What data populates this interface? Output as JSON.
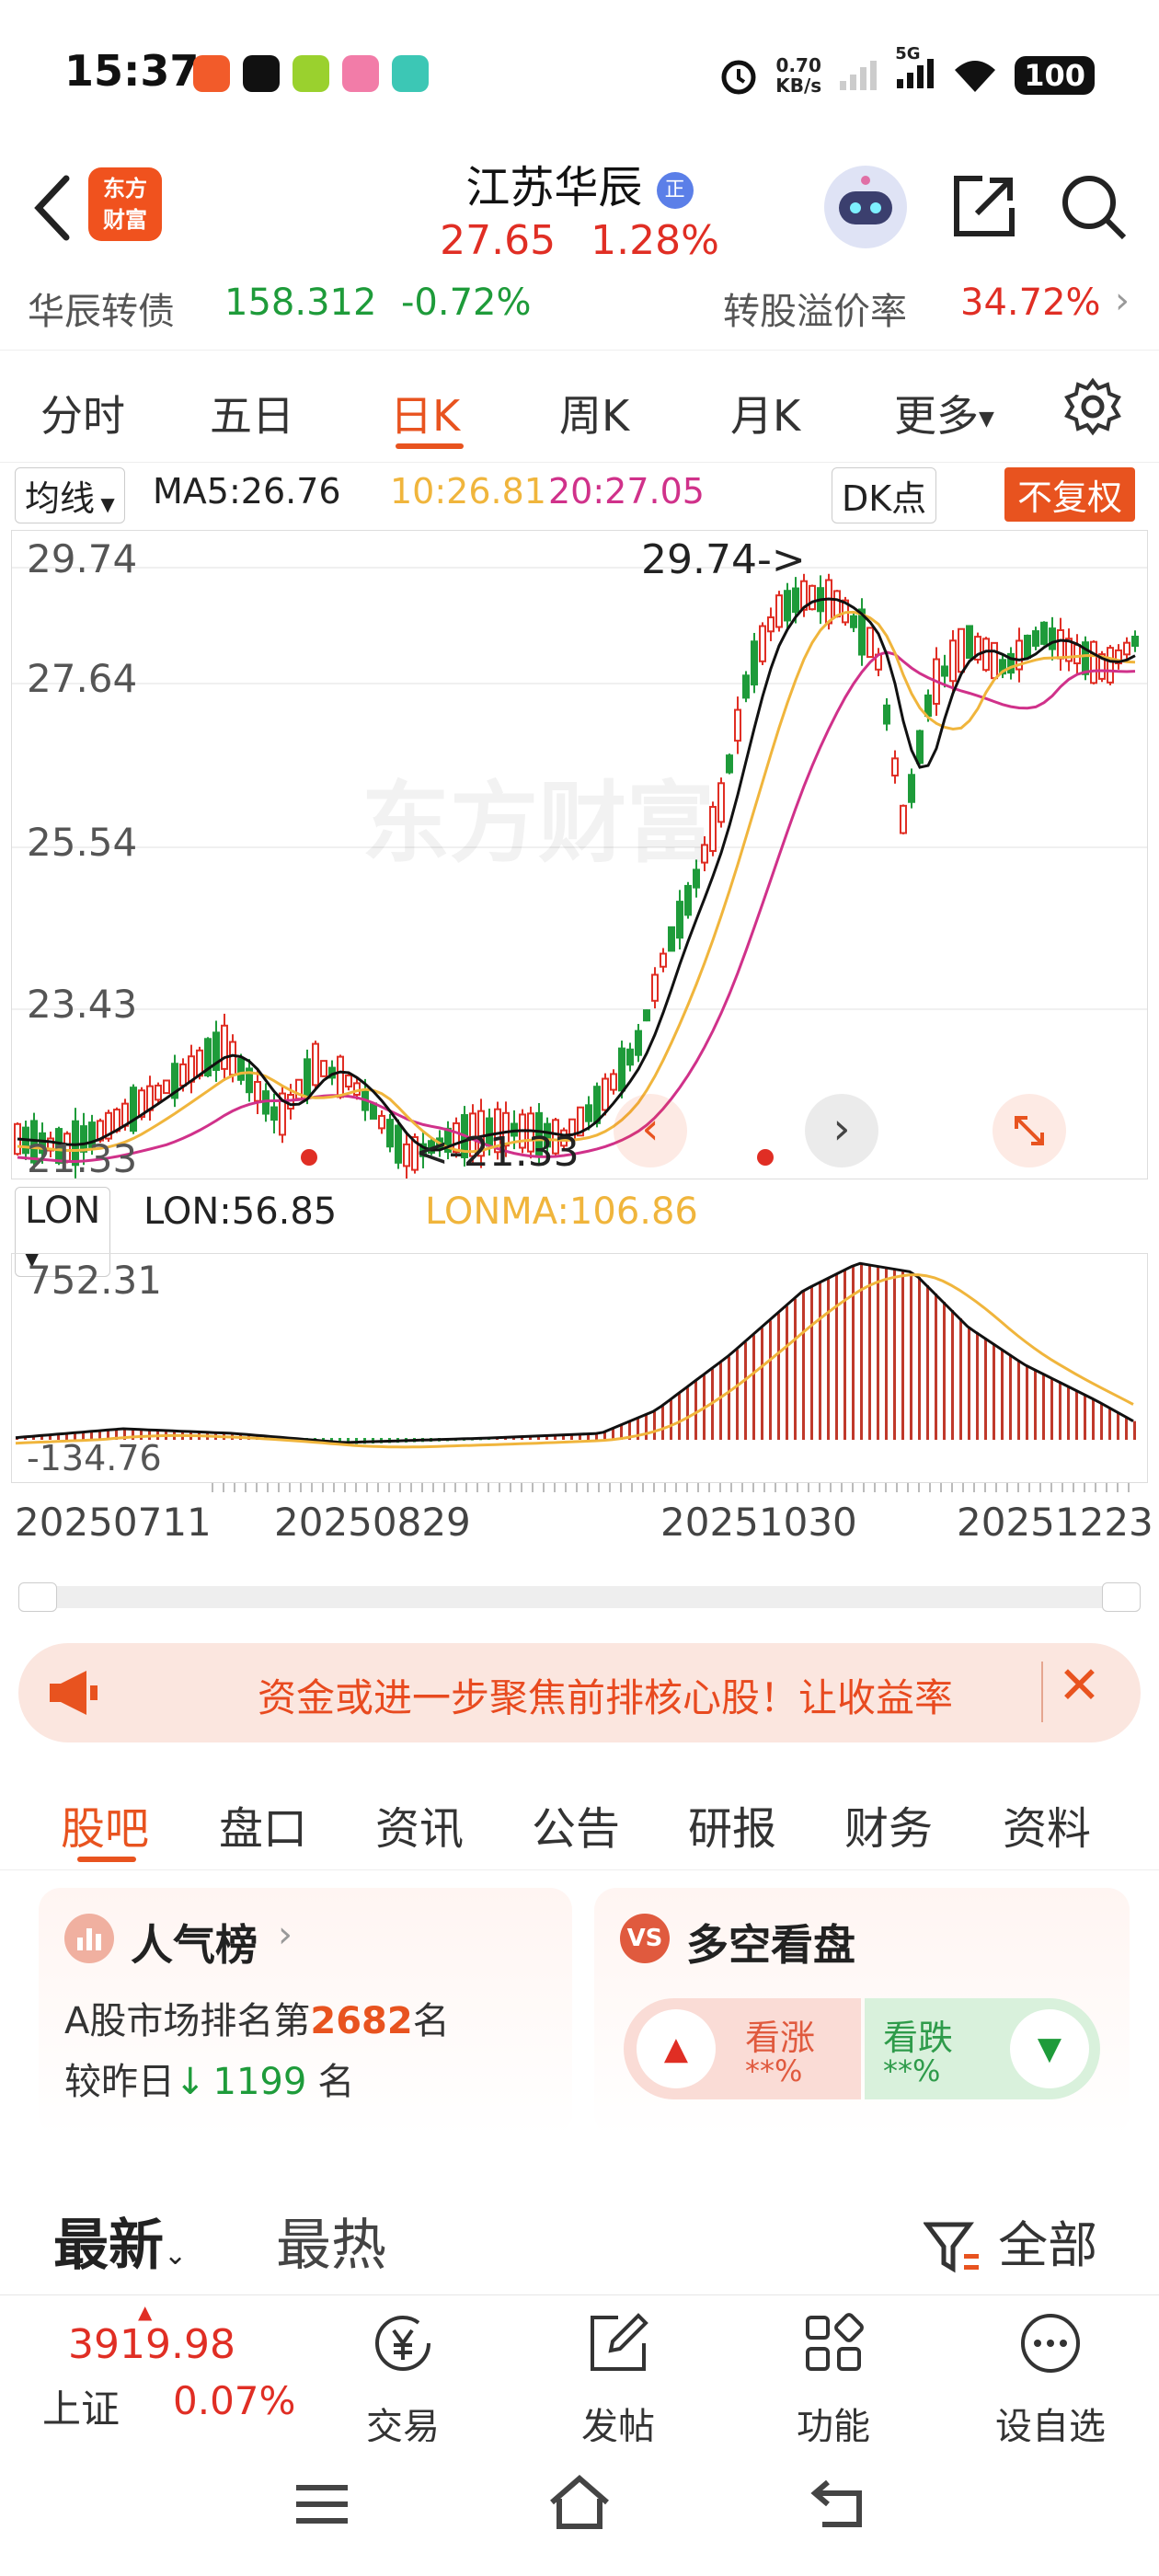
{
  "status_bar": {
    "time": "15:37",
    "net_speed_top": "0.70",
    "net_speed_bottom": "KB/s",
    "network": "5G",
    "battery": "100"
  },
  "header": {
    "logo_line1": "东方",
    "logo_line2": "财富",
    "stock_name": "江苏华辰",
    "badge": "正",
    "price": "27.65",
    "change_pct": "1.28%"
  },
  "convertible_bond": {
    "name": "华辰转债",
    "price": "158.312",
    "change": "-0.72%",
    "premium_label": "转股溢价率",
    "premium_value": "34.72%"
  },
  "period_tabs": [
    {
      "label": "分时",
      "active": false
    },
    {
      "label": "五日",
      "active": false
    },
    {
      "label": "日K",
      "active": true
    },
    {
      "label": "周K",
      "active": false
    },
    {
      "label": "月K",
      "active": false
    },
    {
      "label": "更多",
      "active": false
    }
  ],
  "ma_bar": {
    "selector": "均线",
    "ma5": "MA5:26.76",
    "ma10": "10:26.81",
    "ma20": "20:27.05",
    "dk_label": "DK点",
    "adjust_label": "不复权"
  },
  "kline": {
    "y_labels": [
      "29.74",
      "27.64",
      "25.54",
      "23.43",
      "21.33"
    ],
    "max_marker": "29.74->",
    "min_marker": "<-21.33",
    "watermark": "东方财富"
  },
  "lon": {
    "selector": "LON",
    "lon": "LON:56.85",
    "lonma": "LONMA:106.86",
    "y_top": "752.31",
    "y_bottom": "-134.76"
  },
  "x_labels": [
    "20250711",
    "20250829",
    "20251030",
    "20251223"
  ],
  "banner": {
    "text": "资金或进一步聚焦前排核心股！让收益率"
  },
  "community_tabs": [
    {
      "label": "股吧",
      "active": true
    },
    {
      "label": "盘口",
      "active": false
    },
    {
      "label": "资讯",
      "active": false
    },
    {
      "label": "公告",
      "active": false
    },
    {
      "label": "研报",
      "active": false
    },
    {
      "label": "财务",
      "active": false
    },
    {
      "label": "资料",
      "active": false
    }
  ],
  "popularity": {
    "title": "人气榜",
    "rank_prefix": "A股市场排名第",
    "rank": "2682",
    "rank_suffix": "名",
    "change_prefix": "较昨日",
    "change_value": "1199",
    "change_suffix": "名"
  },
  "long_short": {
    "title": "多空看盘",
    "up_label": "看涨",
    "up_value": "**%",
    "down_label": "看跌",
    "down_value": "**%"
  },
  "feed_tabs": {
    "latest": "最新",
    "hot": "最热",
    "filter": "全部"
  },
  "bottom_bar": {
    "index_value": "3919.98",
    "index_name": "上证",
    "index_change": "0.07%",
    "items": [
      "交易",
      "发帖",
      "功能",
      "设自选"
    ]
  },
  "colors": {
    "up": "#e02e24",
    "down": "#1e9b3a",
    "accent": "#f0521e"
  }
}
